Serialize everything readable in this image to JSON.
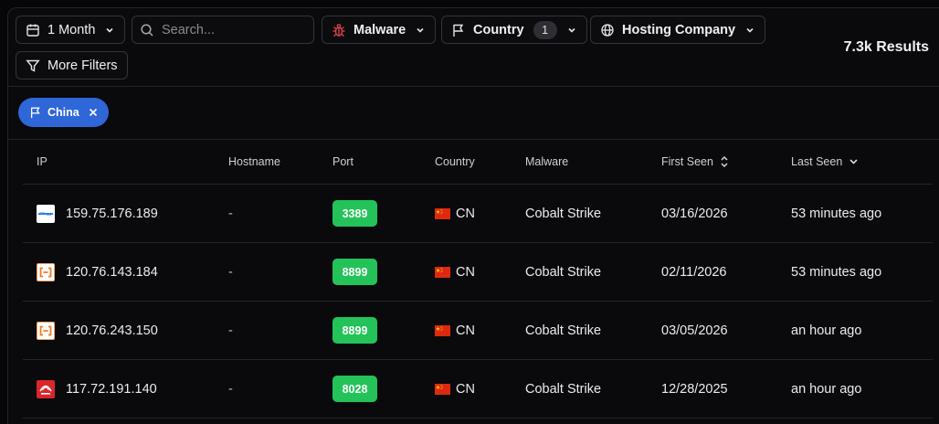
{
  "filters": {
    "time_range": "1 Month",
    "search_placeholder": "Search...",
    "malware_label": "Malware",
    "country_label": "Country",
    "country_count": "1",
    "hosting_label": "Hosting Company",
    "more_filters_label": "More Filters"
  },
  "results_label": "7.3k Results",
  "active_chip": {
    "label": "China"
  },
  "table": {
    "columns": [
      "IP",
      "Hostname",
      "Port",
      "Country",
      "Malware",
      "First Seen",
      "Last Seen"
    ],
    "rows": [
      {
        "logo": "provider-logo-blue",
        "ip": "159.75.176.189",
        "hostname": "-",
        "port": "3389",
        "country_flag": "china-flag-icon",
        "country": "CN",
        "malware": "Cobalt Strike",
        "first_seen": "03/16/2026",
        "last_seen": "53 minutes ago"
      },
      {
        "logo": "alibaba-cloud-logo",
        "ip": "120.76.143.184",
        "hostname": "-",
        "port": "8899",
        "country_flag": "china-flag-icon",
        "country": "CN",
        "malware": "Cobalt Strike",
        "first_seen": "02/11/2026",
        "last_seen": "53 minutes ago"
      },
      {
        "logo": "alibaba-cloud-logo",
        "ip": "120.76.243.150",
        "hostname": "-",
        "port": "8899",
        "country_flag": "china-flag-icon",
        "country": "CN",
        "malware": "Cobalt Strike",
        "first_seen": "03/05/2026",
        "last_seen": "an hour ago"
      },
      {
        "logo": "china-telecom-logo",
        "ip": "117.72.191.140",
        "hostname": "-",
        "port": "8028",
        "country_flag": "china-flag-icon",
        "country": "CN",
        "malware": "Cobalt Strike",
        "first_seen": "12/28/2025",
        "last_seen": "an hour ago"
      }
    ]
  },
  "colors": {
    "chip": "#2f66d8",
    "port_badge": "#23c35a",
    "malware_icon": "#e0454b",
    "background": "#0a0a0c"
  }
}
